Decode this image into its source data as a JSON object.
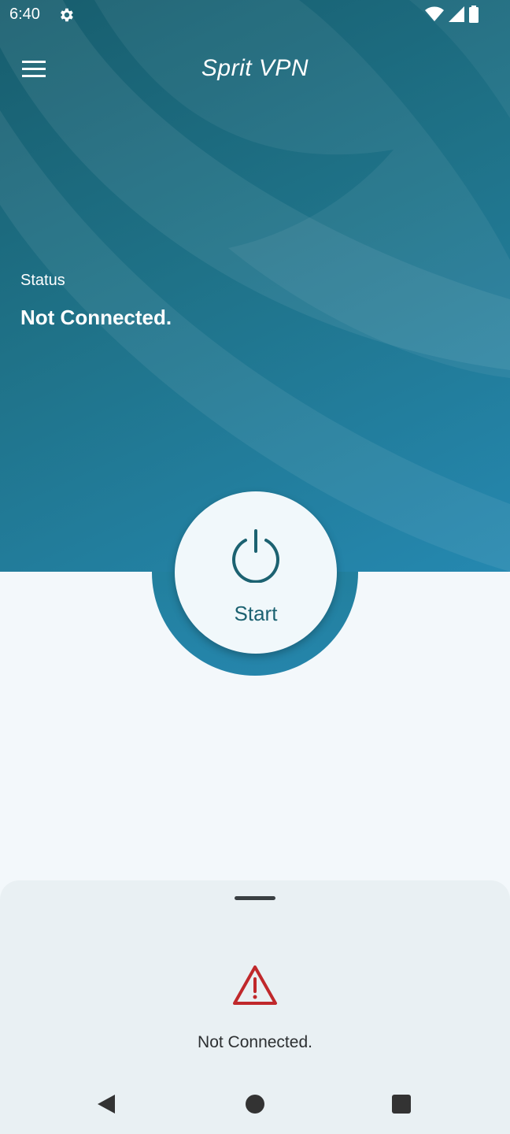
{
  "statusbar": {
    "time": "6:40",
    "icons": [
      "gear-icon",
      "wifi-icon",
      "signal-icon",
      "battery-icon"
    ]
  },
  "appbar": {
    "title": "Sprit VPN",
    "menu_icon": "hamburger-menu-icon"
  },
  "status": {
    "label": "Status",
    "value": "Not Connected."
  },
  "power_button": {
    "icon": "power-icon",
    "label": "Start"
  },
  "bottom_sheet": {
    "icon": "warning-icon",
    "message": "Not Connected."
  },
  "navbar": {
    "icons": [
      "back-icon",
      "home-icon",
      "recents-icon"
    ]
  },
  "colors": {
    "hero_dark": "#175d6d",
    "hero_light": "#2588b0",
    "accent": "#1c6271",
    "warning": "#c0282b",
    "background": "#f3f8fb",
    "sheet": "#e9f0f3"
  }
}
